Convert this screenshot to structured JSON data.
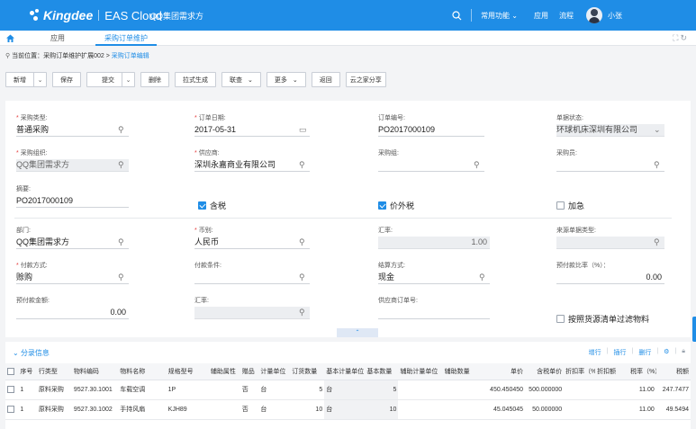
{
  "header": {
    "brand": "Kingdee",
    "product": "EAS Cloud",
    "org": "QQ集团需求方",
    "menu_common": "常用功能",
    "menu_apps": "应用",
    "menu_flow": "流程",
    "username": "小张"
  },
  "tabs": [
    {
      "label": "应用"
    },
    {
      "label": "采购订单维护"
    }
  ],
  "breadcrumb": {
    "prefix": "当前位置：",
    "path": "采购订单维护扩展002 > ",
    "current": "采购订单编辑"
  },
  "toolbar": {
    "new": "新增",
    "save": "保存",
    "submit": "提交",
    "delete": "删除",
    "pull": "拉式生成",
    "related": "联查",
    "more": "更多",
    "back": "返回",
    "share": "云之家分享"
  },
  "form": {
    "purchase_type": {
      "label": "采购类型:",
      "value": "普通采购"
    },
    "order_date": {
      "label": "订单日期:",
      "value": "2017-05-31"
    },
    "order_no": {
      "label": "订单编号:",
      "value": "PO2017000109"
    },
    "doc_status": {
      "label": "单据状态:",
      "value": "环球机床深圳有限公司"
    },
    "purchase_org": {
      "label": "采购组织:",
      "value": "QQ集团需求方"
    },
    "supplier": {
      "label": "供应商:",
      "value": "深圳永嘉商业有限公司"
    },
    "purchase_group": {
      "label": "采购组:",
      "value": ""
    },
    "purchaser": {
      "label": "采购员:",
      "value": ""
    },
    "summary": {
      "label": "摘要:",
      "value": "PO2017000109"
    },
    "tax_included": {
      "label": "含税",
      "checked": true
    },
    "tax_exclusive_price": {
      "label": "价外税",
      "checked": true
    },
    "urgent": {
      "label": "加急",
      "checked": false
    },
    "department": {
      "label": "部门:",
      "value": "QQ集团需求方"
    },
    "currency": {
      "label": "币别:",
      "value": "人民币"
    },
    "exchange_rate": {
      "label": "汇率:",
      "value": "1.00"
    },
    "source_doc_type": {
      "label": "来源单据类型:",
      "value": ""
    },
    "payment_method": {
      "label": "付款方式:",
      "value": "赊购"
    },
    "payment_terms": {
      "label": "付款条件:",
      "value": ""
    },
    "settlement_method": {
      "label": "结算方式:",
      "value": "现金"
    },
    "prepay_ratio": {
      "label": "预付款比率（%）：",
      "value": "0.00"
    },
    "prepay_amount": {
      "label": "预付款金额:",
      "value": "0.00"
    },
    "exchange_rate2": {
      "label": "汇率:",
      "value": ""
    },
    "supplier_order_no": {
      "label": "供应商订单号:",
      "value": ""
    },
    "filter_by_list": {
      "label": "按照货源清单过滤物料",
      "checked": false
    }
  },
  "entries": {
    "title": "分录信息",
    "actions": {
      "add_row": "增行",
      "insert_row": "插行",
      "delete_row": "删行"
    },
    "columns": [
      "序号",
      "行类型",
      "物料编码",
      "物料名称",
      "规格型号",
      "辅助属性",
      "赠品",
      "计量单位",
      "订货数量",
      "基本计量单位",
      "基本数量",
      "辅助计量单位",
      "辅助数量",
      "单价",
      "含税单价",
      "折扣率（%）",
      "折扣额",
      "税率（%）",
      "税额"
    ],
    "rows": [
      {
        "seq": "1",
        "type": "原料采购",
        "code": "9527.30.1001",
        "name": "车载空调",
        "spec": "1P",
        "aux": "",
        "gift": "否",
        "unit": "台",
        "qty": "5",
        "base_unit": "台",
        "base_qty": "5",
        "aux_unit": "",
        "aux_qty": "",
        "price": "450.450450",
        "tax_price": "500.000000",
        "disc_rate": "",
        "disc_amt": "",
        "tax_rate": "11.00",
        "tax": "247.7477"
      },
      {
        "seq": "1",
        "type": "原料采购",
        "code": "9527.30.1002",
        "name": "手持风扇",
        "spec": "KJH89",
        "aux": "",
        "gift": "否",
        "unit": "台",
        "qty": "10",
        "base_unit": "台",
        "base_qty": "10",
        "aux_unit": "",
        "aux_qty": "",
        "price": "45.045045",
        "tax_price": "50.000000",
        "disc_rate": "",
        "disc_amt": "",
        "tax_rate": "11.00",
        "tax": "49.5494"
      }
    ]
  },
  "colors": {
    "primary": "#1f8de6",
    "required": "#e53c3c",
    "page_bg": "#f3f4f6"
  },
  "icons": [
    "home-icon",
    "search-icon",
    "calendar-icon",
    "location-pin-icon",
    "chevron-down-icon",
    "fullscreen-icon",
    "refresh-icon",
    "gear-icon",
    "lock-icon"
  ]
}
